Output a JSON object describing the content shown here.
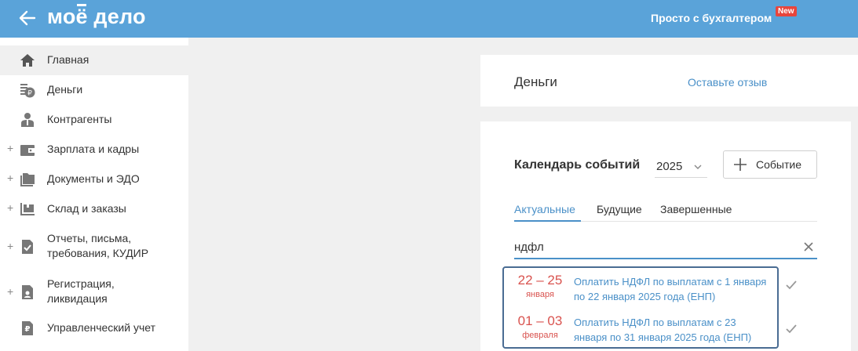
{
  "header": {
    "logo": "моё дело",
    "link": "Просто с бухгалтером",
    "badge": "New"
  },
  "sidebar": {
    "items": [
      {
        "label": "Главная",
        "icon": "home-icon",
        "plus": false
      },
      {
        "label": "Деньги",
        "icon": "coins-icon",
        "plus": false
      },
      {
        "label": "Контрагенты",
        "icon": "person-icon",
        "plus": false
      },
      {
        "label": "Зарплата и кадры",
        "icon": "wallet-icon",
        "plus": true
      },
      {
        "label": "Документы и ЭДО",
        "icon": "folder-icon",
        "plus": true
      },
      {
        "label": "Склад и заказы",
        "icon": "warehouse-icon",
        "plus": true
      },
      {
        "label": "Отчеты, письма, требования, КУДИР",
        "icon": "report-icon",
        "plus": true
      },
      {
        "label": "Регистрация, ликвидация",
        "icon": "registration-icon",
        "plus": true
      },
      {
        "label": "Управленческий учет",
        "icon": "ruble-doc-icon",
        "plus": false
      }
    ]
  },
  "money_card": {
    "title": "Деньги",
    "feedback": "Оставьте отзыв"
  },
  "calendar": {
    "title": "Календарь событий",
    "year": "2025",
    "add_button": "Событие",
    "tabs": [
      "Актуальные",
      "Будущие",
      "Завершенные"
    ],
    "search_value": "ндфл",
    "events": [
      {
        "dates": "22 – 25",
        "month": "января",
        "text": "Оплатить НДФЛ по выплатам с 1 января по 22 января 2025 года (ЕНП)"
      },
      {
        "dates": "01 – 03",
        "month": "февраля",
        "text": "Оплатить НДФЛ по выплатам с 23 января по 31 января 2025 года (ЕНП)"
      }
    ]
  },
  "colors": {
    "header": "#5aa3d9",
    "accent": "#4a90c8",
    "date_red": "#d9534f",
    "badge": "#e8453c"
  }
}
